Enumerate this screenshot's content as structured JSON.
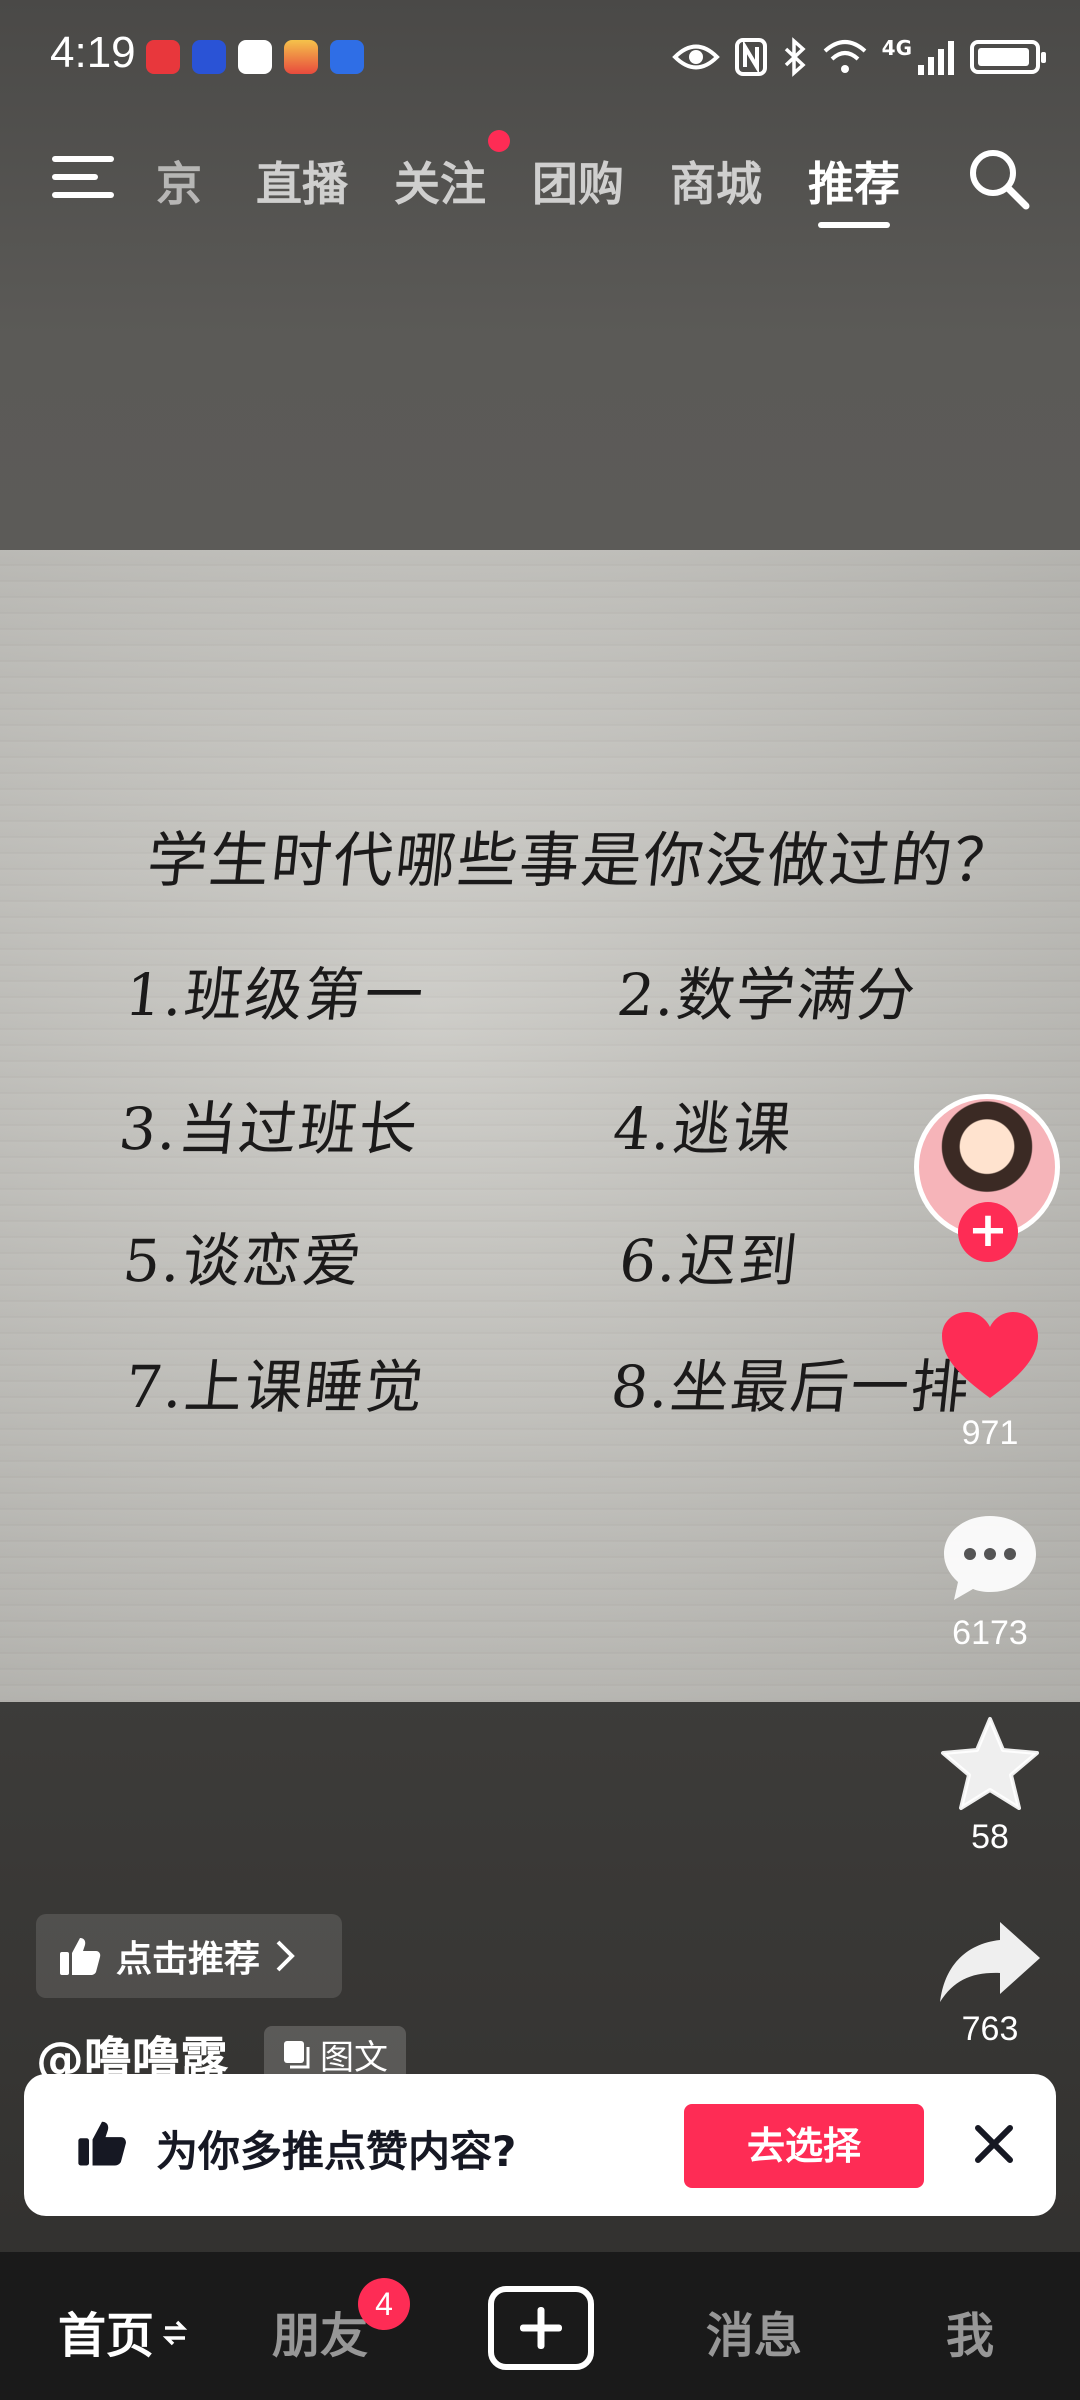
{
  "status_bar": {
    "time": "4:19",
    "network": "4G",
    "battery_level": 0.95,
    "notification_icons": [
      "huawei-app-icon",
      "blue-app-icon",
      "china-mobile-icon",
      "photos-app-icon",
      "blue-shield-app-icon"
    ]
  },
  "top_nav": {
    "tabs": [
      "京",
      "直播",
      "关注",
      "团购",
      "商城",
      "推荐"
    ],
    "active_tab": "推荐"
  },
  "post": {
    "title": "学生时代哪些事是你没做过的？",
    "items": [
      "1.班级第一",
      "2.数学满分",
      "3.当过班长",
      "4.逃课",
      "5.谈恋爱",
      "6.迟到",
      "7.上课睡觉",
      "8.坐最后一排"
    ]
  },
  "actions": {
    "likes": "971",
    "comments": "6173",
    "favorites": "58",
    "shares": "763"
  },
  "info": {
    "recommend_label": "点击推荐",
    "author": "@噜噜露",
    "type_badge": "图文"
  },
  "popup": {
    "text": "为你多推点赞内容?",
    "button": "去选择"
  },
  "bottom_nav": {
    "items": [
      "首页",
      "朋友",
      "消息",
      "我"
    ],
    "friends_badge": "4"
  },
  "colors": {
    "accent": "#fe2c55",
    "nav_bg": "#1a1a1a"
  }
}
